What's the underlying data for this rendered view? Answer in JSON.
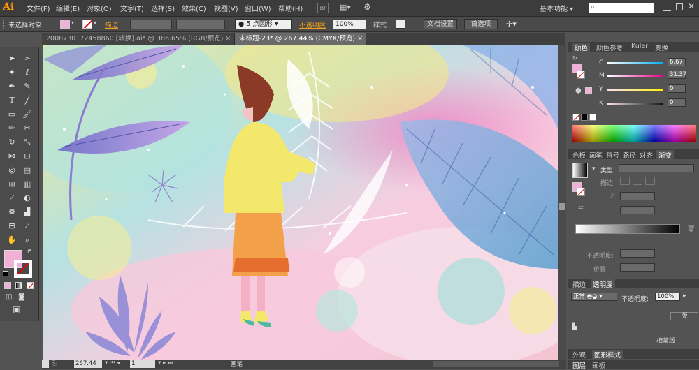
{
  "app": {
    "logo": "Ai"
  },
  "menus": [
    "文件(F)",
    "编辑(E)",
    "对象(O)",
    "文字(T)",
    "选择(S)",
    "效果(C)",
    "视图(V)",
    "窗口(W)",
    "帮助(H)"
  ],
  "workspace": {
    "label": "基本功能"
  },
  "control": {
    "no_selection": "未选择对象",
    "stroke_label": "描边",
    "brush_label": "5 点圆形",
    "opacity_label": "不透明度",
    "opacity_value": "100%",
    "style_label": "样式",
    "doc_setup": "文档设置",
    "prefs": "首选项"
  },
  "tabs": [
    {
      "label": "2008730172458860 [转换].ai* @ 386.65% (RGB/预览)",
      "close": "×"
    },
    {
      "label": "未标题-23* @ 267.44% (CMYK/预览)",
      "close": "×"
    }
  ],
  "status": {
    "zoom": "267.44",
    "page": "1",
    "mode": "画笔"
  },
  "color_panel": {
    "tabs": [
      "颜色",
      "颜色参考",
      "Kuler",
      "变换"
    ],
    "channels": [
      {
        "label": "C",
        "value": "6.67",
        "color": "#00aeef"
      },
      {
        "label": "M",
        "value": "31.37",
        "color": "#ec008c"
      },
      {
        "label": "Y",
        "value": "0",
        "color": "#fff200"
      },
      {
        "label": "K",
        "value": "0",
        "color": "#111111"
      }
    ],
    "swatch": "#f0b0d8"
  },
  "gradient_panel": {
    "tabs": [
      "色板",
      "画笔",
      "符号",
      "路径",
      "对齐",
      "渐变"
    ],
    "type_label": "类型",
    "stroke_label": "描边",
    "opacity_label": "不透明度",
    "position_label": "位置"
  },
  "transparency_panel": {
    "tabs": [
      "描边",
      "透明度"
    ],
    "mode": "正常",
    "opacity_label": "不透明度",
    "opacity_value": "100%",
    "btn1": "版",
    "btn2": "相蒙版"
  },
  "appearance_panel": {
    "tabs": [
      "外观",
      "图形样式"
    ]
  },
  "layers_panel": {
    "tabs": [
      "图层",
      "画板"
    ]
  },
  "toolbar": {
    "fill": "#f0b0d8"
  }
}
